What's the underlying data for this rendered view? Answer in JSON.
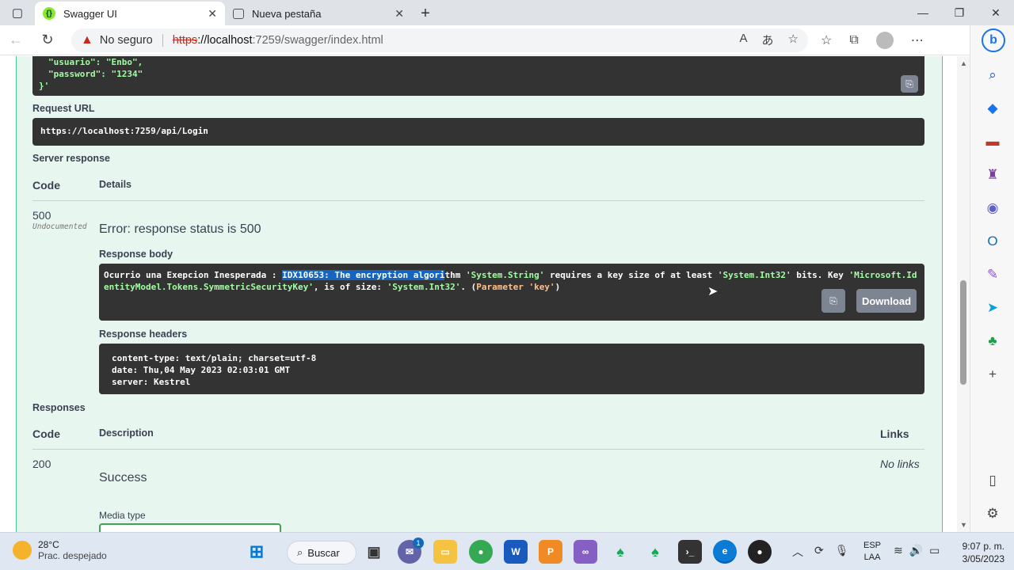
{
  "browser": {
    "tabs": [
      {
        "title": "Swagger UI",
        "active": true
      },
      {
        "title": "Nueva pestaña",
        "active": false
      }
    ],
    "security_label": "No seguro",
    "url_scheme": "https",
    "url_host": "://localhost",
    "url_rest": ":7259/swagger/index.html"
  },
  "request": {
    "body_lines": [
      "\"usuario\": \"Enbo\",",
      "\"password\": \"1234\"",
      "}'"
    ],
    "url_label": "Request URL",
    "url": "https://localhost:7259/api/Login"
  },
  "server_response": {
    "label": "Server response",
    "col_code": "Code",
    "col_details": "Details",
    "code": "500",
    "code_note": "Undocumented",
    "error_title": "Error: response status is 500",
    "body_label": "Response body",
    "body_parts": {
      "p1": "Ocurrio una Exepcion Inesperada : ",
      "p2": "IDX10653: The encryption algori",
      "p3": "thm ",
      "p4": "'System.String'",
      "p5": " requires a key size of at least ",
      "p6": "'System.Int32'",
      "p7": " bits. Key ",
      "p8": "'Microsoft.Ide",
      "p9": "ntityModel.Tokens.SymmetricSecurityKey'",
      "p10": ", is of size: ",
      "p11": "'System.Int32'",
      "p12": ". (",
      "p13": "Parameter 'key'",
      "p14": ")"
    },
    "download_label": "Download",
    "headers_label": "Response headers",
    "headers": [
      "content-type: text/plain; charset=utf-8",
      "date: Thu,04 May 2023 02:03:01 GMT",
      "server: Kestrel"
    ]
  },
  "responses": {
    "label": "Responses",
    "col_code": "Code",
    "col_description": "Description",
    "col_links": "Links",
    "code": "200",
    "no_links": "No links",
    "description": "Success",
    "media_type_label": "Media type"
  },
  "taskbar": {
    "weather_temp": "28°C",
    "weather_desc": "Prac. despejado",
    "search_label": "Buscar",
    "lang_1": "ESP",
    "lang_2": "LAA",
    "time": "9:07 p. m.",
    "date": "3/05/2023",
    "teams_badge": "1"
  },
  "colors": {
    "accent_green": "#49cc90",
    "panel_bg": "#e8f6f0",
    "dark_block": "#333333",
    "selection": "#1565c0"
  }
}
